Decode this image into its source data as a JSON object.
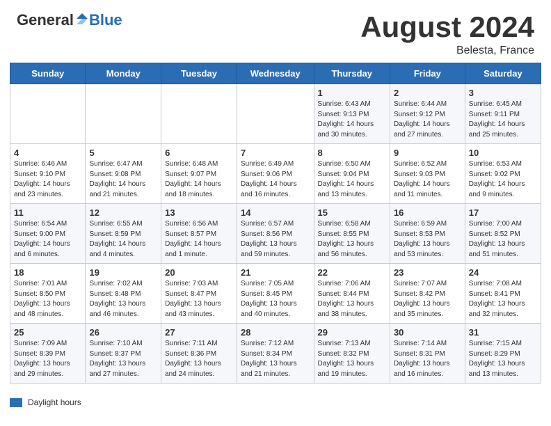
{
  "header": {
    "logo_general": "General",
    "logo_blue": "Blue",
    "title": "August 2024",
    "location": "Belesta, France"
  },
  "days_of_week": [
    "Sunday",
    "Monday",
    "Tuesday",
    "Wednesday",
    "Thursday",
    "Friday",
    "Saturday"
  ],
  "footer": {
    "legend_label": "Daylight hours"
  },
  "weeks": [
    [
      {
        "num": "",
        "detail": ""
      },
      {
        "num": "",
        "detail": ""
      },
      {
        "num": "",
        "detail": ""
      },
      {
        "num": "",
        "detail": ""
      },
      {
        "num": "1",
        "detail": "Sunrise: 6:43 AM\nSunset: 9:13 PM\nDaylight: 14 hours\nand 30 minutes."
      },
      {
        "num": "2",
        "detail": "Sunrise: 6:44 AM\nSunset: 9:12 PM\nDaylight: 14 hours\nand 27 minutes."
      },
      {
        "num": "3",
        "detail": "Sunrise: 6:45 AM\nSunset: 9:11 PM\nDaylight: 14 hours\nand 25 minutes."
      }
    ],
    [
      {
        "num": "4",
        "detail": "Sunrise: 6:46 AM\nSunset: 9:10 PM\nDaylight: 14 hours\nand 23 minutes."
      },
      {
        "num": "5",
        "detail": "Sunrise: 6:47 AM\nSunset: 9:08 PM\nDaylight: 14 hours\nand 21 minutes."
      },
      {
        "num": "6",
        "detail": "Sunrise: 6:48 AM\nSunset: 9:07 PM\nDaylight: 14 hours\nand 18 minutes."
      },
      {
        "num": "7",
        "detail": "Sunrise: 6:49 AM\nSunset: 9:06 PM\nDaylight: 14 hours\nand 16 minutes."
      },
      {
        "num": "8",
        "detail": "Sunrise: 6:50 AM\nSunset: 9:04 PM\nDaylight: 14 hours\nand 13 minutes."
      },
      {
        "num": "9",
        "detail": "Sunrise: 6:52 AM\nSunset: 9:03 PM\nDaylight: 14 hours\nand 11 minutes."
      },
      {
        "num": "10",
        "detail": "Sunrise: 6:53 AM\nSunset: 9:02 PM\nDaylight: 14 hours\nand 9 minutes."
      }
    ],
    [
      {
        "num": "11",
        "detail": "Sunrise: 6:54 AM\nSunset: 9:00 PM\nDaylight: 14 hours\nand 6 minutes."
      },
      {
        "num": "12",
        "detail": "Sunrise: 6:55 AM\nSunset: 8:59 PM\nDaylight: 14 hours\nand 4 minutes."
      },
      {
        "num": "13",
        "detail": "Sunrise: 6:56 AM\nSunset: 8:57 PM\nDaylight: 14 hours\nand 1 minute."
      },
      {
        "num": "14",
        "detail": "Sunrise: 6:57 AM\nSunset: 8:56 PM\nDaylight: 13 hours\nand 59 minutes."
      },
      {
        "num": "15",
        "detail": "Sunrise: 6:58 AM\nSunset: 8:55 PM\nDaylight: 13 hours\nand 56 minutes."
      },
      {
        "num": "16",
        "detail": "Sunrise: 6:59 AM\nSunset: 8:53 PM\nDaylight: 13 hours\nand 53 minutes."
      },
      {
        "num": "17",
        "detail": "Sunrise: 7:00 AM\nSunset: 8:52 PM\nDaylight: 13 hours\nand 51 minutes."
      }
    ],
    [
      {
        "num": "18",
        "detail": "Sunrise: 7:01 AM\nSunset: 8:50 PM\nDaylight: 13 hours\nand 48 minutes."
      },
      {
        "num": "19",
        "detail": "Sunrise: 7:02 AM\nSunset: 8:48 PM\nDaylight: 13 hours\nand 46 minutes."
      },
      {
        "num": "20",
        "detail": "Sunrise: 7:03 AM\nSunset: 8:47 PM\nDaylight: 13 hours\nand 43 minutes."
      },
      {
        "num": "21",
        "detail": "Sunrise: 7:05 AM\nSunset: 8:45 PM\nDaylight: 13 hours\nand 40 minutes."
      },
      {
        "num": "22",
        "detail": "Sunrise: 7:06 AM\nSunset: 8:44 PM\nDaylight: 13 hours\nand 38 minutes."
      },
      {
        "num": "23",
        "detail": "Sunrise: 7:07 AM\nSunset: 8:42 PM\nDaylight: 13 hours\nand 35 minutes."
      },
      {
        "num": "24",
        "detail": "Sunrise: 7:08 AM\nSunset: 8:41 PM\nDaylight: 13 hours\nand 32 minutes."
      }
    ],
    [
      {
        "num": "25",
        "detail": "Sunrise: 7:09 AM\nSunset: 8:39 PM\nDaylight: 13 hours\nand 29 minutes."
      },
      {
        "num": "26",
        "detail": "Sunrise: 7:10 AM\nSunset: 8:37 PM\nDaylight: 13 hours\nand 27 minutes."
      },
      {
        "num": "27",
        "detail": "Sunrise: 7:11 AM\nSunset: 8:36 PM\nDaylight: 13 hours\nand 24 minutes."
      },
      {
        "num": "28",
        "detail": "Sunrise: 7:12 AM\nSunset: 8:34 PM\nDaylight: 13 hours\nand 21 minutes."
      },
      {
        "num": "29",
        "detail": "Sunrise: 7:13 AM\nSunset: 8:32 PM\nDaylight: 13 hours\nand 19 minutes."
      },
      {
        "num": "30",
        "detail": "Sunrise: 7:14 AM\nSunset: 8:31 PM\nDaylight: 13 hours\nand 16 minutes."
      },
      {
        "num": "31",
        "detail": "Sunrise: 7:15 AM\nSunset: 8:29 PM\nDaylight: 13 hours\nand 13 minutes."
      }
    ]
  ]
}
